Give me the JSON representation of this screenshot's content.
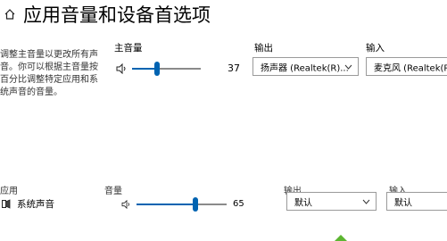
{
  "header": {
    "title": "应用音量和设备首选项"
  },
  "description": "调整主音量以更改所有声音。你可以根据主音量按百分比调整特定应用和系统声音的音量。",
  "master": {
    "label": "主音量",
    "value": "37",
    "level_percent": 37,
    "icon": "speaker-icon"
  },
  "output_label": "输出",
  "input_label": "输入",
  "master_output": {
    "selected": "扬声器 (Realtek(R)..."
  },
  "master_input": {
    "selected": "麦克风 (Realtek(R)..."
  },
  "columns": {
    "app": "应用",
    "volume": "音量",
    "output": "输出",
    "input": "输入"
  },
  "apps": [
    {
      "name": "系统声音",
      "volume": "65",
      "level_percent": 65,
      "output": "默认",
      "input": "默认",
      "icon": "system-sounds-icon"
    }
  ],
  "colors": {
    "accent": "#0063b1",
    "track": "#8a8a8a"
  }
}
